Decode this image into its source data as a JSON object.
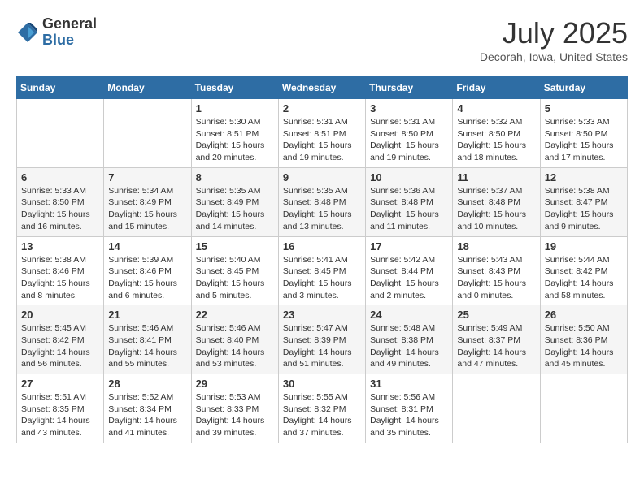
{
  "logo": {
    "general": "General",
    "blue": "Blue"
  },
  "title": "July 2025",
  "subtitle": "Decorah, Iowa, United States",
  "weekdays": [
    "Sunday",
    "Monday",
    "Tuesday",
    "Wednesday",
    "Thursday",
    "Friday",
    "Saturday"
  ],
  "weeks": [
    [
      {
        "day": "",
        "info": ""
      },
      {
        "day": "",
        "info": ""
      },
      {
        "day": "1",
        "info": "Sunrise: 5:30 AM\nSunset: 8:51 PM\nDaylight: 15 hours and 20 minutes."
      },
      {
        "day": "2",
        "info": "Sunrise: 5:31 AM\nSunset: 8:51 PM\nDaylight: 15 hours and 19 minutes."
      },
      {
        "day": "3",
        "info": "Sunrise: 5:31 AM\nSunset: 8:50 PM\nDaylight: 15 hours and 19 minutes."
      },
      {
        "day": "4",
        "info": "Sunrise: 5:32 AM\nSunset: 8:50 PM\nDaylight: 15 hours and 18 minutes."
      },
      {
        "day": "5",
        "info": "Sunrise: 5:33 AM\nSunset: 8:50 PM\nDaylight: 15 hours and 17 minutes."
      }
    ],
    [
      {
        "day": "6",
        "info": "Sunrise: 5:33 AM\nSunset: 8:50 PM\nDaylight: 15 hours and 16 minutes."
      },
      {
        "day": "7",
        "info": "Sunrise: 5:34 AM\nSunset: 8:49 PM\nDaylight: 15 hours and 15 minutes."
      },
      {
        "day": "8",
        "info": "Sunrise: 5:35 AM\nSunset: 8:49 PM\nDaylight: 15 hours and 14 minutes."
      },
      {
        "day": "9",
        "info": "Sunrise: 5:35 AM\nSunset: 8:48 PM\nDaylight: 15 hours and 13 minutes."
      },
      {
        "day": "10",
        "info": "Sunrise: 5:36 AM\nSunset: 8:48 PM\nDaylight: 15 hours and 11 minutes."
      },
      {
        "day": "11",
        "info": "Sunrise: 5:37 AM\nSunset: 8:48 PM\nDaylight: 15 hours and 10 minutes."
      },
      {
        "day": "12",
        "info": "Sunrise: 5:38 AM\nSunset: 8:47 PM\nDaylight: 15 hours and 9 minutes."
      }
    ],
    [
      {
        "day": "13",
        "info": "Sunrise: 5:38 AM\nSunset: 8:46 PM\nDaylight: 15 hours and 8 minutes."
      },
      {
        "day": "14",
        "info": "Sunrise: 5:39 AM\nSunset: 8:46 PM\nDaylight: 15 hours and 6 minutes."
      },
      {
        "day": "15",
        "info": "Sunrise: 5:40 AM\nSunset: 8:45 PM\nDaylight: 15 hours and 5 minutes."
      },
      {
        "day": "16",
        "info": "Sunrise: 5:41 AM\nSunset: 8:45 PM\nDaylight: 15 hours and 3 minutes."
      },
      {
        "day": "17",
        "info": "Sunrise: 5:42 AM\nSunset: 8:44 PM\nDaylight: 15 hours and 2 minutes."
      },
      {
        "day": "18",
        "info": "Sunrise: 5:43 AM\nSunset: 8:43 PM\nDaylight: 15 hours and 0 minutes."
      },
      {
        "day": "19",
        "info": "Sunrise: 5:44 AM\nSunset: 8:42 PM\nDaylight: 14 hours and 58 minutes."
      }
    ],
    [
      {
        "day": "20",
        "info": "Sunrise: 5:45 AM\nSunset: 8:42 PM\nDaylight: 14 hours and 56 minutes."
      },
      {
        "day": "21",
        "info": "Sunrise: 5:46 AM\nSunset: 8:41 PM\nDaylight: 14 hours and 55 minutes."
      },
      {
        "day": "22",
        "info": "Sunrise: 5:46 AM\nSunset: 8:40 PM\nDaylight: 14 hours and 53 minutes."
      },
      {
        "day": "23",
        "info": "Sunrise: 5:47 AM\nSunset: 8:39 PM\nDaylight: 14 hours and 51 minutes."
      },
      {
        "day": "24",
        "info": "Sunrise: 5:48 AM\nSunset: 8:38 PM\nDaylight: 14 hours and 49 minutes."
      },
      {
        "day": "25",
        "info": "Sunrise: 5:49 AM\nSunset: 8:37 PM\nDaylight: 14 hours and 47 minutes."
      },
      {
        "day": "26",
        "info": "Sunrise: 5:50 AM\nSunset: 8:36 PM\nDaylight: 14 hours and 45 minutes."
      }
    ],
    [
      {
        "day": "27",
        "info": "Sunrise: 5:51 AM\nSunset: 8:35 PM\nDaylight: 14 hours and 43 minutes."
      },
      {
        "day": "28",
        "info": "Sunrise: 5:52 AM\nSunset: 8:34 PM\nDaylight: 14 hours and 41 minutes."
      },
      {
        "day": "29",
        "info": "Sunrise: 5:53 AM\nSunset: 8:33 PM\nDaylight: 14 hours and 39 minutes."
      },
      {
        "day": "30",
        "info": "Sunrise: 5:55 AM\nSunset: 8:32 PM\nDaylight: 14 hours and 37 minutes."
      },
      {
        "day": "31",
        "info": "Sunrise: 5:56 AM\nSunset: 8:31 PM\nDaylight: 14 hours and 35 minutes."
      },
      {
        "day": "",
        "info": ""
      },
      {
        "day": "",
        "info": ""
      }
    ]
  ]
}
